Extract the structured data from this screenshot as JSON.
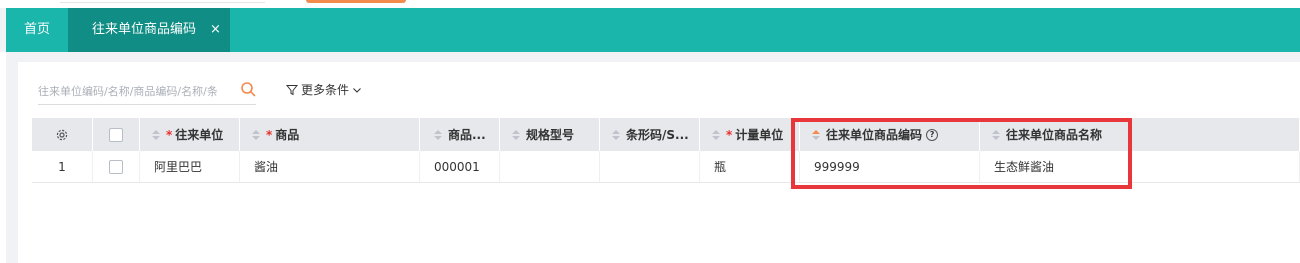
{
  "tabs": [
    {
      "label": "首页"
    },
    {
      "label": "往来单位商品编码",
      "close": "×"
    }
  ],
  "search": {
    "placeholder": "往来单位编码/名称/商品编码/名称/条"
  },
  "filter": {
    "label": "更多条件"
  },
  "table": {
    "headers": {
      "partner": "往来单位",
      "product": "商品",
      "product_code": "商品...",
      "spec": "规格型号",
      "barcode": "条形码/S...",
      "unit": "计量单位",
      "partner_code": "往来单位商品编码",
      "partner_name": "往来单位商品名称"
    },
    "rows": [
      {
        "index": "1",
        "partner": "阿里巴巴",
        "product": "酱油",
        "product_code": "000001",
        "spec": "",
        "barcode": "",
        "unit": "瓶",
        "partner_code": "999999",
        "partner_name": "生态鲜酱油"
      }
    ]
  },
  "colors": {
    "tabbar": "#1ab5ab",
    "active_tab": "#108e85",
    "highlight_box": "#e8373b",
    "accent_orange": "#f28b4b",
    "required_star": "#e5322d"
  },
  "icons": [
    "search-icon",
    "filter-icon",
    "chevron-down-icon",
    "gear-icon",
    "help-icon",
    "sort-icon"
  ]
}
